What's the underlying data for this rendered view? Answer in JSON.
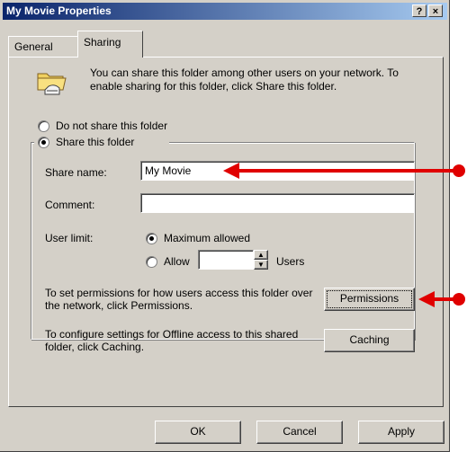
{
  "window": {
    "title": "My Movie Properties",
    "help_button": "?",
    "close_button": "×"
  },
  "tabs": [
    {
      "label": "General",
      "selected": false
    },
    {
      "label": "Sharing",
      "selected": true
    }
  ],
  "sharing": {
    "description": "You can share this folder among other users on your network.  To enable sharing for this folder, click Share this folder.",
    "option_not_share": {
      "label": "Do not share this folder",
      "selected": false
    },
    "option_share": {
      "label": "Share this folder",
      "selected": true
    },
    "share_name": {
      "label": "Share name:",
      "value": "My Movie"
    },
    "comment": {
      "label": "Comment:",
      "value": ""
    },
    "user_limit": {
      "label": "User limit:",
      "max_allowed": {
        "label": "Maximum allowed",
        "selected": true
      },
      "allow": {
        "label": "Allow",
        "selected": false
      },
      "users_value": "",
      "users_label": "Users"
    },
    "permissions_text": "To set permissions for how users access this folder over the network, click Permissions.",
    "permissions_button": "Permissions",
    "caching_text": "To configure settings for Offline access to this shared folder, click Caching.",
    "caching_button": "Caching"
  },
  "footer": {
    "ok": "OK",
    "cancel": "Cancel",
    "apply": "Apply"
  },
  "annotation_color": "#e00000"
}
